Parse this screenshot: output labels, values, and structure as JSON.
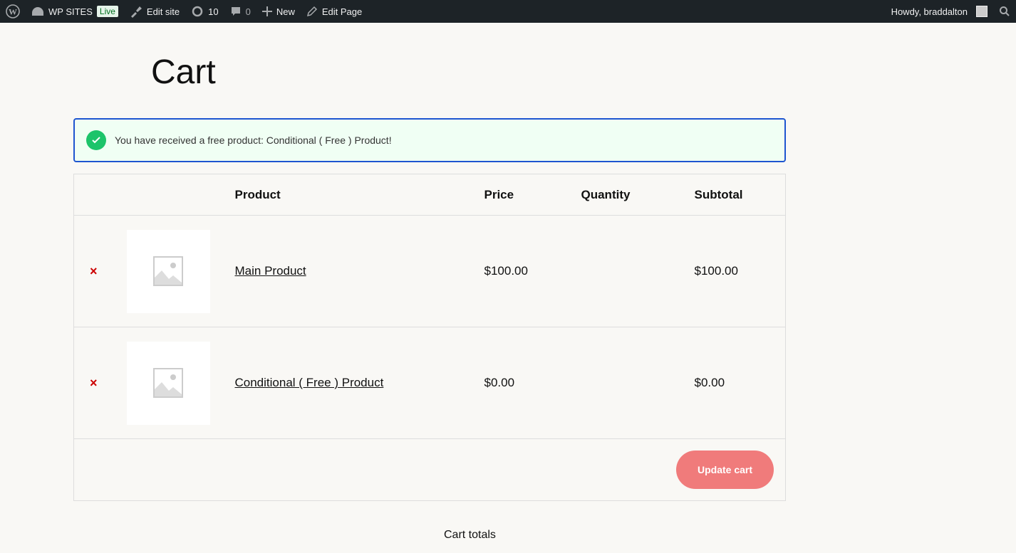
{
  "admin_bar": {
    "site_name": "WP SITES",
    "live_badge": "Live",
    "edit_site": "Edit site",
    "updates": "10",
    "comments": "0",
    "new": "New",
    "edit_page": "Edit Page",
    "howdy": "Howdy, braddalton"
  },
  "page": {
    "title": "Cart"
  },
  "notice": {
    "text": "You have received a free product: Conditional ( Free ) Product!"
  },
  "table": {
    "headers": {
      "product": "Product",
      "price": "Price",
      "quantity": "Quantity",
      "subtotal": "Subtotal"
    },
    "rows": [
      {
        "name": "Main Product",
        "price": "$100.00",
        "subtotal": "$100.00"
      },
      {
        "name": "Conditional ( Free ) Product",
        "price": "$0.00",
        "subtotal": "$0.00"
      }
    ],
    "remove_symbol": "×",
    "update_cart": "Update cart"
  },
  "cart_totals": "Cart totals"
}
